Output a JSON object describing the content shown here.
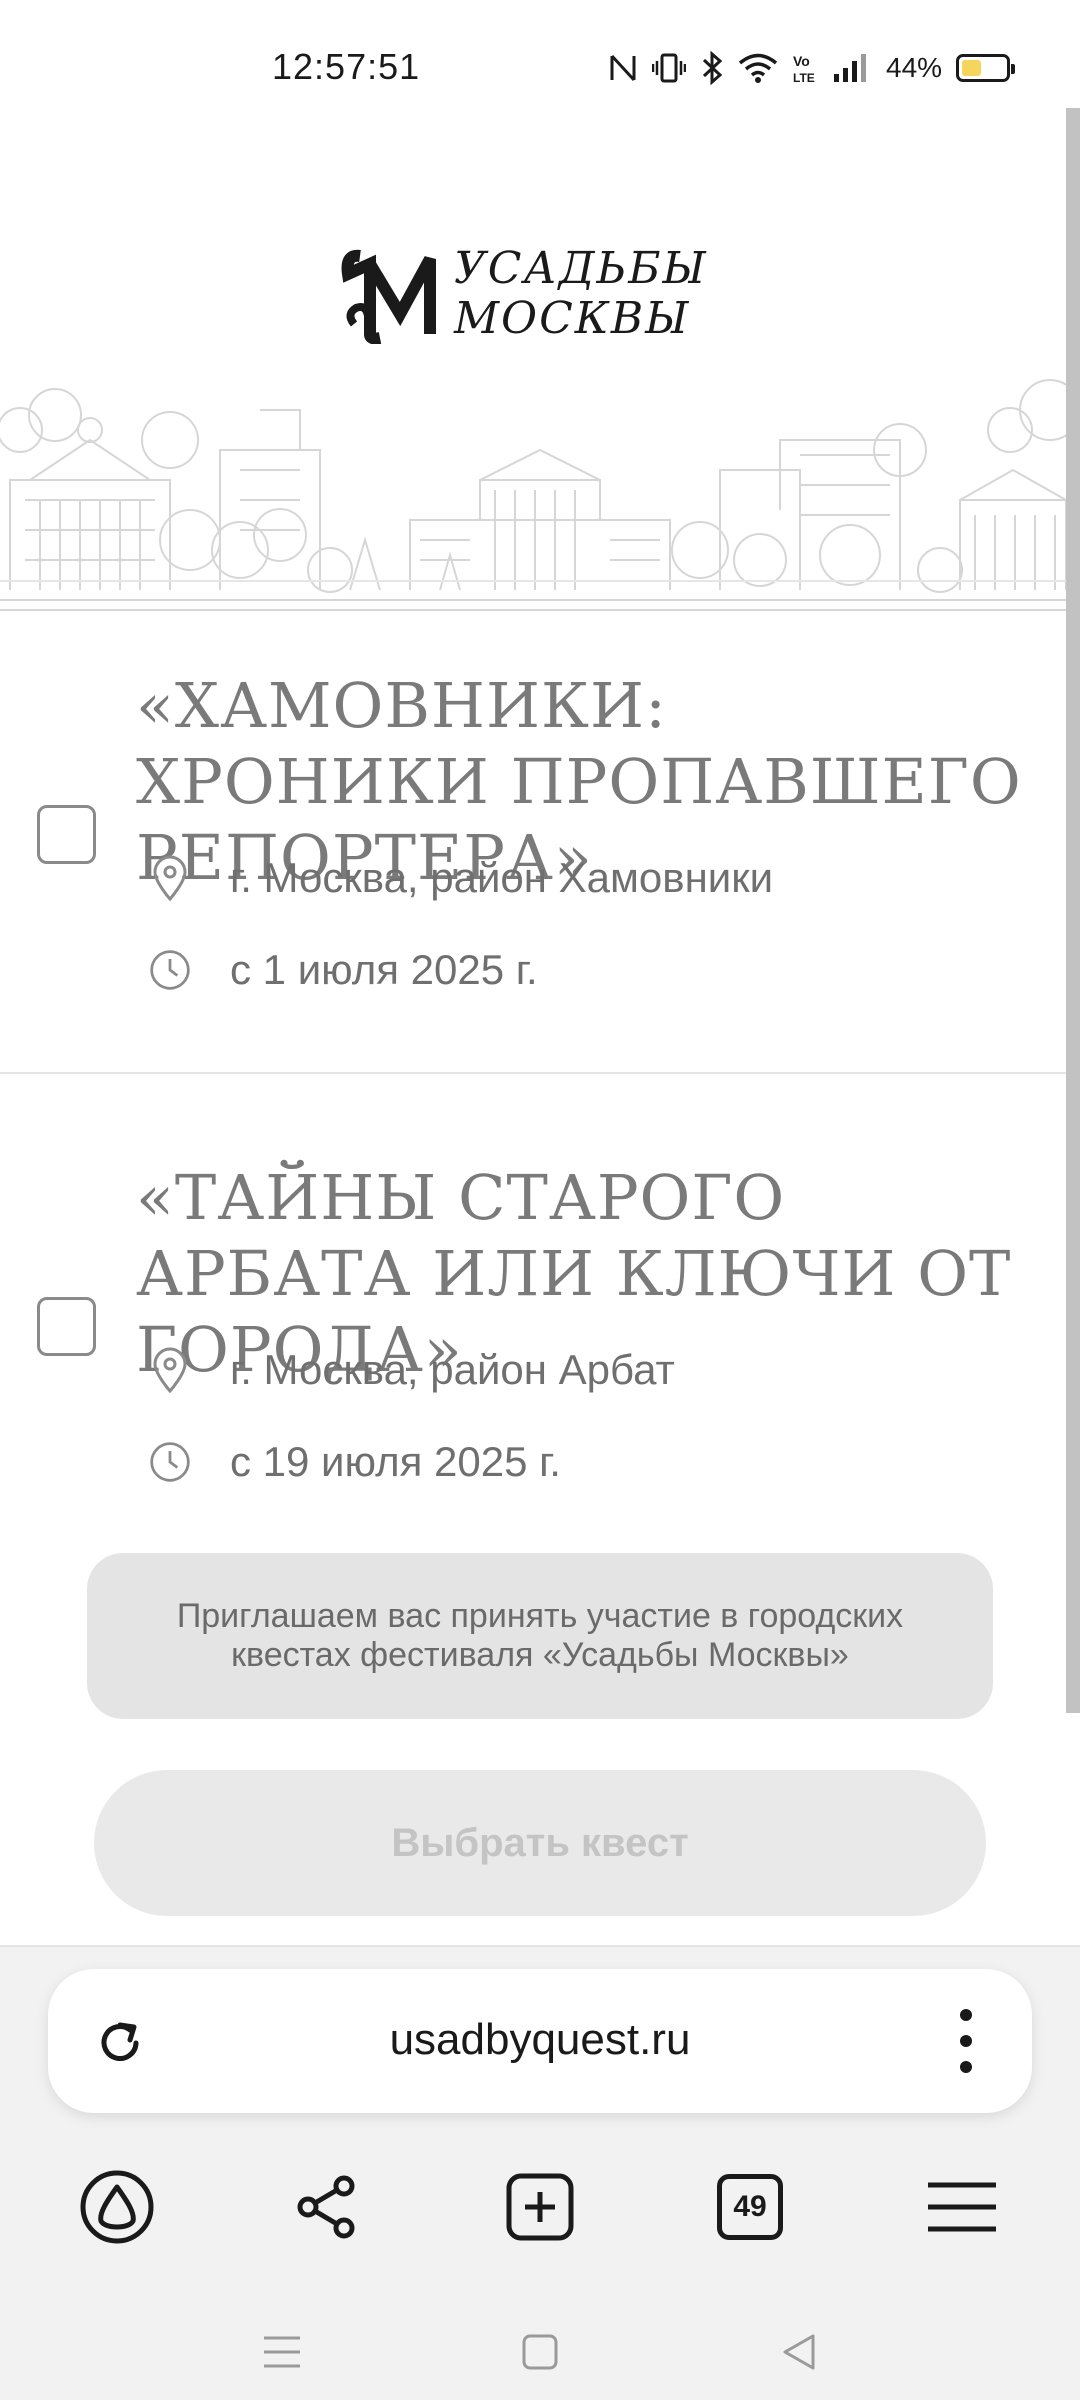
{
  "status_bar": {
    "time": "12:57:51",
    "battery_percent": "44%",
    "battery_level": 0.44,
    "icons": [
      "nfc-icon",
      "vibrate-icon",
      "bluetooth-icon",
      "wifi-icon",
      "volte-icon",
      "signal-icon",
      "battery-icon"
    ]
  },
  "header": {
    "logo_mark": "М",
    "logo_line1": "УСАДЬБЫ",
    "logo_line2": "МОСКВЫ"
  },
  "quests": [
    {
      "title": "«ХАМОВНИКИ: ХРОНИКИ ПРОПАВШЕГО РЕПОРТЕРА»",
      "location": "г. Москва, район Хамовники",
      "date": "с 1 июля 2025 г.",
      "checked": false
    },
    {
      "title": "«ТАЙНЫ СТАРОГО АРБАТА ИЛИ КЛЮЧИ ОТ ГОРОДА»",
      "location": "г. Москва, район Арбат",
      "date": "с 19 июля 2025 г.",
      "checked": false
    }
  ],
  "invite_text": "Приглашаем вас принять участие в городских квестах фестиваля «Усадьбы Москвы»",
  "choose_button_label": "Выбрать квест",
  "browser": {
    "url": "usadbyquest.ru",
    "tab_count": "49"
  },
  "colors": {
    "title_gray": "#7a7a7a",
    "meta_gray": "#6f6f6f",
    "invite_bg": "#e4e4e4",
    "button_bg": "#e9e9e9",
    "battery_fill": "#f6d55c"
  }
}
